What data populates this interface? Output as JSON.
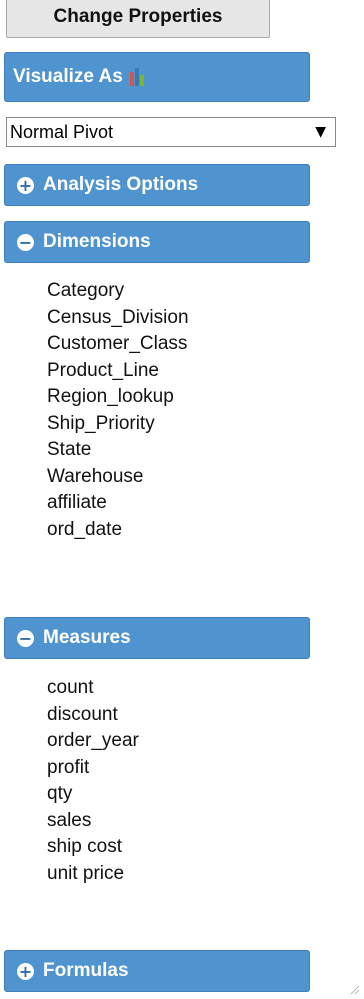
{
  "change_button": {
    "label": "Change Properties"
  },
  "visualize": {
    "label": "Visualize As",
    "icon": "bar-chart-icon"
  },
  "pivot_select": {
    "value": "Normal Pivot",
    "arrow": "▼"
  },
  "analysis_options": {
    "label": "Analysis Options",
    "state": "collapsed"
  },
  "dimensions": {
    "label": "Dimensions",
    "state": "expanded",
    "items": [
      "Category",
      "Census_Division",
      "Customer_Class",
      "Product_Line",
      "Region_lookup",
      "Ship_Priority",
      "State",
      "Warehouse",
      "affiliate",
      "ord_date"
    ]
  },
  "measures": {
    "label": "Measures",
    "state": "expanded",
    "items": [
      "count",
      "discount",
      "order_year",
      "profit",
      "qty",
      "sales",
      "ship cost",
      "unit price"
    ]
  },
  "formulas": {
    "label": "Formulas",
    "state": "collapsed"
  },
  "colors": {
    "header_bg": "#4f93cf",
    "bar_red": "#d9534f",
    "bar_blue": "#337ab7",
    "bar_green": "#7fb236"
  }
}
